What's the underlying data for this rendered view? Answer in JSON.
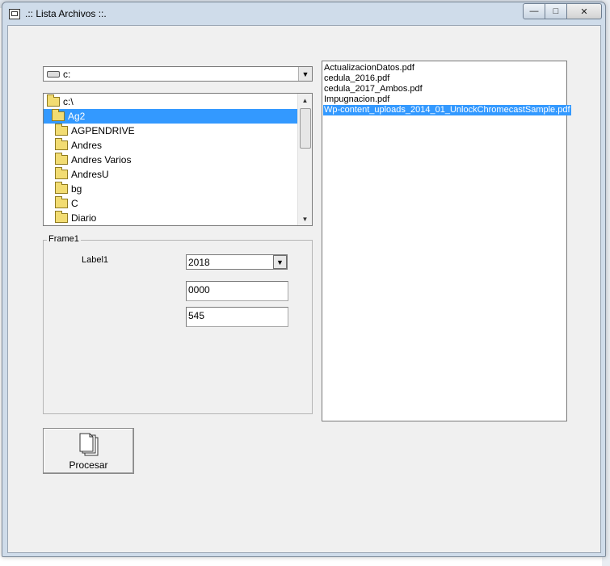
{
  "window": {
    "title": ".:: Lista Archivos ::.",
    "controls": {
      "minimize": "—",
      "maximize": "□",
      "close": "✕"
    }
  },
  "drive_combo": {
    "value": "c:"
  },
  "dir_list": {
    "items": [
      {
        "label": "c:\\",
        "icon": "open-folder-icon",
        "level": 0,
        "selected": false
      },
      {
        "label": "Ag2",
        "icon": "open-folder-icon",
        "level": 1,
        "selected": true
      },
      {
        "label": "AGPENDRIVE",
        "icon": "folder-icon",
        "level": 2,
        "selected": false
      },
      {
        "label": "Andres",
        "icon": "folder-icon",
        "level": 2,
        "selected": false
      },
      {
        "label": "Andres Varios",
        "icon": "folder-icon",
        "level": 2,
        "selected": false
      },
      {
        "label": "AndresU",
        "icon": "folder-icon",
        "level": 2,
        "selected": false
      },
      {
        "label": "bg",
        "icon": "folder-icon",
        "level": 2,
        "selected": false
      },
      {
        "label": "C",
        "icon": "folder-icon",
        "level": 2,
        "selected": false
      },
      {
        "label": "Diario",
        "icon": "folder-icon",
        "level": 2,
        "selected": false
      }
    ]
  },
  "frame1": {
    "legend": "Frame1",
    "label": "Label1",
    "year_combo": "2018",
    "text1": "0000",
    "text2": "545"
  },
  "file_list": {
    "items": [
      {
        "label": "ActualizacionDatos.pdf",
        "selected": false
      },
      {
        "label": "cedula_2016.pdf",
        "selected": false
      },
      {
        "label": "cedula_2017_Ambos.pdf",
        "selected": false
      },
      {
        "label": "Impugnacion.pdf",
        "selected": false
      },
      {
        "label": "Wp-content_uploads_2014_01_UnlockChromecastSample.pdf",
        "selected": true
      }
    ]
  },
  "process_button": {
    "label": "Procesar",
    "icon": "documents-icon"
  },
  "colors": {
    "selection": "#3399ff",
    "form_bg": "#f0f0f0",
    "folder": "#f2dc72"
  }
}
